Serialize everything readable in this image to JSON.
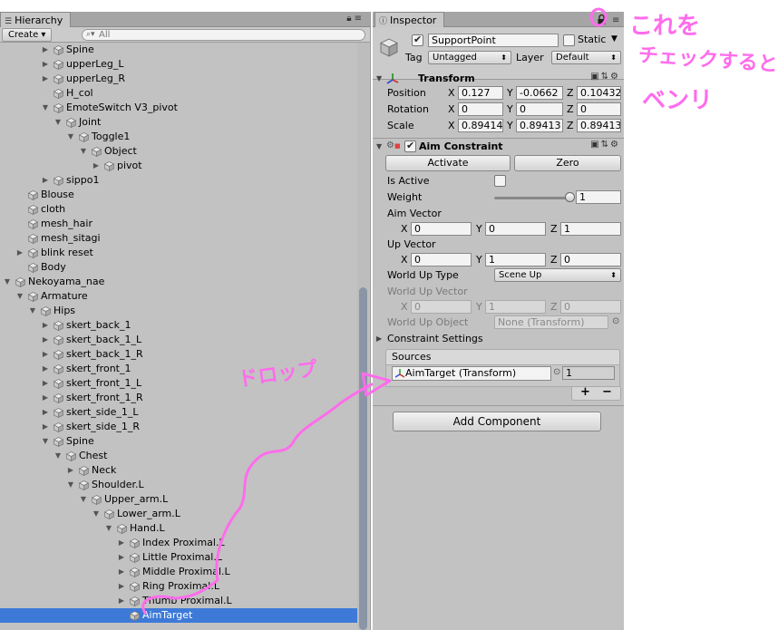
{
  "hierarchy": {
    "tab_label": "Hierarchy",
    "create_label": "Create",
    "search_placeholder": "All",
    "rows": [
      {
        "name": "Spine",
        "depth": 4,
        "arrow": "right",
        "selected": false
      },
      {
        "name": "upperLeg_L",
        "depth": 4,
        "arrow": "right",
        "selected": false
      },
      {
        "name": "upperLeg_R",
        "depth": 4,
        "arrow": "right",
        "selected": false
      },
      {
        "name": "H_col",
        "depth": 4,
        "arrow": "none",
        "selected": false
      },
      {
        "name": "EmoteSwitch V3_pivot",
        "depth": 4,
        "arrow": "down",
        "selected": false
      },
      {
        "name": "Joint",
        "depth": 5,
        "arrow": "down",
        "selected": false
      },
      {
        "name": "Toggle1",
        "depth": 6,
        "arrow": "down",
        "selected": false
      },
      {
        "name": "Object",
        "depth": 7,
        "arrow": "down",
        "selected": false
      },
      {
        "name": "pivot",
        "depth": 8,
        "arrow": "right",
        "selected": false
      },
      {
        "name": "sippo1",
        "depth": 4,
        "arrow": "right",
        "selected": false
      },
      {
        "name": "Blouse",
        "depth": 2,
        "arrow": "none",
        "selected": false
      },
      {
        "name": "cloth",
        "depth": 2,
        "arrow": "none",
        "selected": false
      },
      {
        "name": "mesh_hair",
        "depth": 2,
        "arrow": "none",
        "selected": false
      },
      {
        "name": "mesh_sitagi",
        "depth": 2,
        "arrow": "none",
        "selected": false
      },
      {
        "name": "blink reset",
        "depth": 2,
        "arrow": "right",
        "selected": false
      },
      {
        "name": "Body",
        "depth": 2,
        "arrow": "none",
        "selected": false
      },
      {
        "name": "Nekoyama_nae",
        "depth": 1,
        "arrow": "down",
        "selected": false
      },
      {
        "name": "Armature",
        "depth": 2,
        "arrow": "down",
        "selected": false
      },
      {
        "name": "Hips",
        "depth": 3,
        "arrow": "down",
        "selected": false
      },
      {
        "name": "skert_back_1",
        "depth": 4,
        "arrow": "right",
        "selected": false
      },
      {
        "name": "skert_back_1_L",
        "depth": 4,
        "arrow": "right",
        "selected": false
      },
      {
        "name": "skert_back_1_R",
        "depth": 4,
        "arrow": "right",
        "selected": false
      },
      {
        "name": "skert_front_1",
        "depth": 4,
        "arrow": "right",
        "selected": false
      },
      {
        "name": "skert_front_1_L",
        "depth": 4,
        "arrow": "right",
        "selected": false
      },
      {
        "name": "skert_front_1_R",
        "depth": 4,
        "arrow": "right",
        "selected": false
      },
      {
        "name": "skert_side_1_L",
        "depth": 4,
        "arrow": "right",
        "selected": false
      },
      {
        "name": "skert_side_1_R",
        "depth": 4,
        "arrow": "right",
        "selected": false
      },
      {
        "name": "Spine",
        "depth": 4,
        "arrow": "down",
        "selected": false
      },
      {
        "name": "Chest",
        "depth": 5,
        "arrow": "down",
        "selected": false
      },
      {
        "name": "Neck",
        "depth": 6,
        "arrow": "right",
        "selected": false
      },
      {
        "name": "Shoulder.L",
        "depth": 6,
        "arrow": "down",
        "selected": false
      },
      {
        "name": "Upper_arm.L",
        "depth": 7,
        "arrow": "down",
        "selected": false
      },
      {
        "name": "Lower_arm.L",
        "depth": 8,
        "arrow": "down",
        "selected": false
      },
      {
        "name": "Hand.L",
        "depth": 9,
        "arrow": "down",
        "selected": false
      },
      {
        "name": "Index Proximal.L",
        "depth": 10,
        "arrow": "right",
        "selected": false
      },
      {
        "name": "Little Proximal.L",
        "depth": 10,
        "arrow": "right",
        "selected": false
      },
      {
        "name": "Middle Proximal.L",
        "depth": 10,
        "arrow": "right",
        "selected": false
      },
      {
        "name": "Ring Proximal.L",
        "depth": 10,
        "arrow": "right",
        "selected": false
      },
      {
        "name": "Thumb Proximal.L",
        "depth": 10,
        "arrow": "right",
        "selected": false
      },
      {
        "name": "AimTarget",
        "depth": 10,
        "arrow": "none",
        "selected": true
      }
    ]
  },
  "inspector": {
    "tab_label": "Inspector",
    "object_name": "SupportPoint",
    "static_label": "Static",
    "tag_label": "Tag",
    "tag_value": "Untagged",
    "layer_label": "Layer",
    "layer_value": "Default",
    "transform": {
      "title": "Transform",
      "position_label": "Position",
      "rotation_label": "Rotation",
      "scale_label": "Scale",
      "x_label": "X",
      "y_label": "Y",
      "z_label": "Z",
      "position": {
        "x": "0.127",
        "y": "-0.0662",
        "z": "0.10432"
      },
      "rotation": {
        "x": "0",
        "y": "0",
        "z": "0"
      },
      "scale": {
        "x": "0.89414",
        "y": "0.89413",
        "z": "0.89413"
      }
    },
    "aim": {
      "title": "Aim Constraint",
      "activate_label": "Activate",
      "zero_label": "Zero",
      "is_active_label": "Is Active",
      "weight_label": "Weight",
      "weight_value": "1",
      "weight_fraction": 1,
      "aim_vector_label": "Aim Vector",
      "aim_vector": {
        "x": "0",
        "y": "0",
        "z": "1"
      },
      "up_vector_label": "Up Vector",
      "up_vector": {
        "x": "0",
        "y": "1",
        "z": "0"
      },
      "world_up_type_label": "World Up Type",
      "world_up_type_value": "Scene Up",
      "world_up_vector_label": "World Up Vector",
      "world_up_vector": {
        "x": "0",
        "y": "1",
        "z": "0"
      },
      "world_up_object_label": "World Up Object",
      "world_up_object_value": "None (Transform)",
      "constraint_settings_label": "Constraint Settings",
      "sources_label": "Sources",
      "source_item": "AimTarget (Transform)",
      "source_weight": "1",
      "plus_label": "+",
      "minus_label": "−"
    },
    "add_component_label": "Add Component"
  },
  "annotations": {
    "note_line1": "これを",
    "note_line2": "チェックすると",
    "note_line3": "ベンリ",
    "drop_label": "ドロップ",
    "color": "#ff6cec"
  }
}
